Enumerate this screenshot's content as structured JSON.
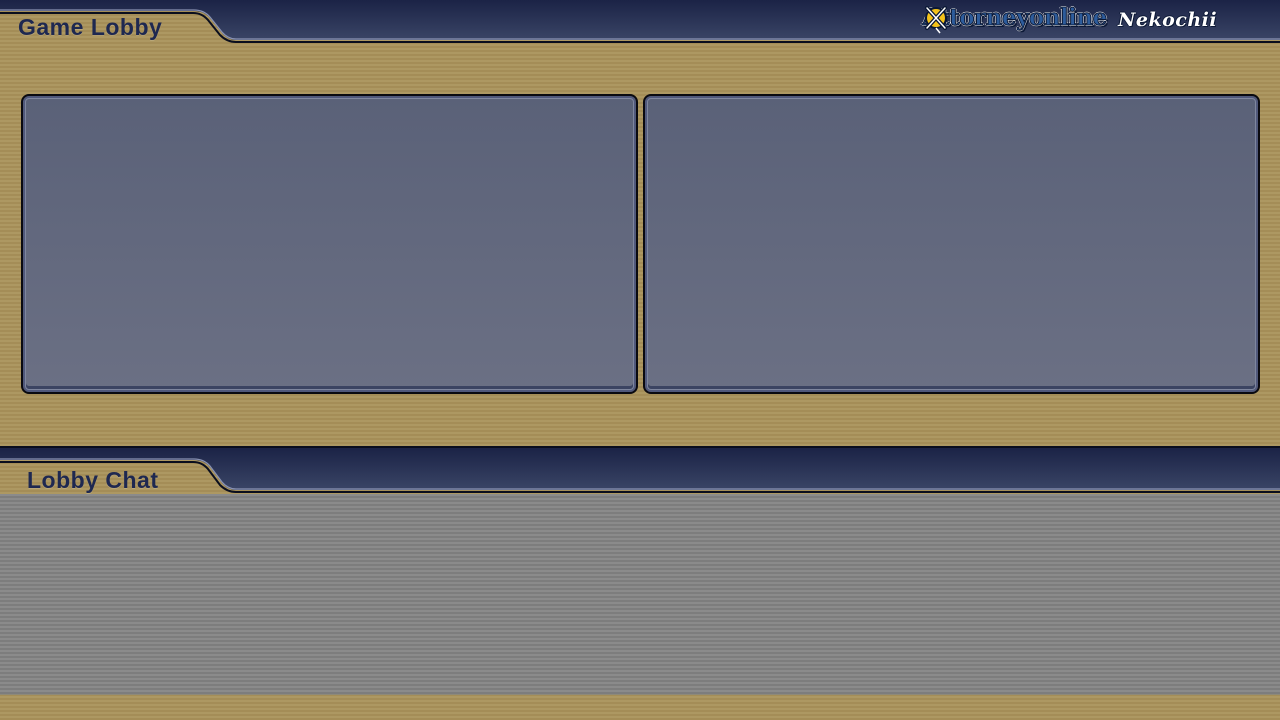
{
  "lobby": {
    "title": "Game Lobby"
  },
  "chat": {
    "title": "Lobby Chat"
  },
  "logo": {
    "text_main": "Attorneyonline",
    "text_script": "Nekochii",
    "emblem_icon": "gavel-cross-emblem-icon"
  },
  "colors": {
    "header_navy": "#1e2850",
    "background_gold": "#ad9862",
    "panel_slate": "#5a6178",
    "chat_gray": "#8b8b8b"
  }
}
